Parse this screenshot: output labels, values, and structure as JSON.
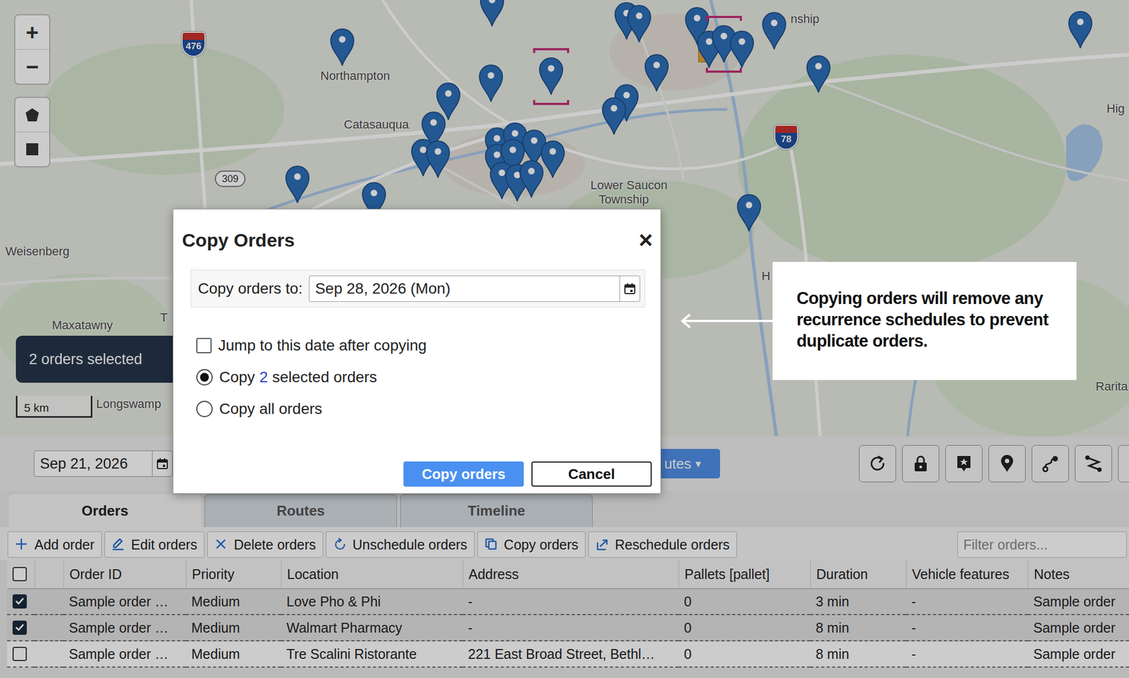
{
  "map": {
    "zoom_controls": [
      "+",
      "−"
    ],
    "labels": [
      "Northampton",
      "Catasauqua",
      "Weisenberg",
      "Maxatawny",
      "Longswamp",
      "Lower Saucon",
      "Township",
      "nship",
      "Hig",
      "H",
      "Rarita",
      "T"
    ],
    "shields": [
      "476",
      "309",
      "78"
    ],
    "pins": [
      {
        "selected": false
      },
      {
        "selected": false
      },
      {
        "selected": true
      },
      {
        "selected": false
      },
      {
        "selected": false
      },
      {
        "selected": false
      },
      {
        "selected": false
      },
      {
        "selected": false
      },
      {
        "selected": false
      },
      {
        "selected": false
      },
      {
        "selected": false
      },
      {
        "selected": false
      },
      {
        "selected": false
      },
      {
        "selected": false
      },
      {
        "selected": true
      },
      {
        "selected": false
      },
      {
        "selected": false
      },
      {
        "selected": false
      },
      {
        "selected": false
      },
      {
        "selected": false
      },
      {
        "selected": false
      },
      {
        "selected": false
      },
      {
        "selected": false
      },
      {
        "selected": false
      },
      {
        "selected": false
      },
      {
        "selected": false
      },
      {
        "selected": false
      },
      {
        "selected": false
      },
      {
        "selected": false
      },
      {
        "selected": false
      },
      {
        "selected": false
      },
      {
        "selected": false
      }
    ],
    "selection_badge": "2 orders selected",
    "scale": "5 km"
  },
  "toolbar": {
    "date": "Sep 21, 2026",
    "routes_button": {
      "label": "utes",
      "caret": "▾"
    }
  },
  "tabs": [
    {
      "label": "Orders",
      "selected": true
    },
    {
      "label": "Routes",
      "selected": false
    },
    {
      "label": "Timeline",
      "selected": false
    }
  ],
  "actions": [
    "Add order",
    "Edit orders",
    "Delete orders",
    "Unschedule orders",
    "Copy orders",
    "Reschedule orders"
  ],
  "filter": {
    "placeholder": "Filter orders..."
  },
  "table": {
    "header_checked": false,
    "columns": [
      "Order ID",
      "Priority",
      "Location",
      "Address",
      "Pallets [pallet]",
      "Duration",
      "Vehicle features",
      "Notes"
    ],
    "rows": [
      {
        "checked": true,
        "selected": true,
        "cells": [
          "Sample order …",
          "Medium",
          "Love Pho & Phi",
          "-",
          "0",
          "3 min",
          "-",
          "Sample order"
        ]
      },
      {
        "checked": true,
        "selected": true,
        "cells": [
          "Sample order …",
          "Medium",
          "Walmart Pharmacy",
          "-",
          "0",
          "8 min",
          "-",
          "Sample order"
        ]
      },
      {
        "checked": false,
        "selected": false,
        "cells": [
          "Sample order …",
          "Medium",
          "Tre Scalini Ristorante",
          "221 East Broad Street, Bethl…",
          "0",
          "8 min",
          "-",
          "Sample order"
        ]
      }
    ]
  },
  "dialog": {
    "title": "Copy Orders",
    "close": "×",
    "date_label": "Copy orders to:",
    "date_value": "Sep 28, 2026 (Mon)",
    "jump": {
      "label": "Jump to this date after copying",
      "checked": false
    },
    "options": [
      {
        "text": "Copy",
        "count": "2",
        "text_after": "selected orders",
        "selected": true
      },
      {
        "text": "Copy all orders",
        "selected": false
      }
    ],
    "buttons": [
      {
        "label": "Copy orders",
        "kind": "primary"
      },
      {
        "label": "Cancel",
        "kind": "secondary"
      }
    ]
  },
  "callout": {
    "text": "Copying orders will remove any recurrence schedules to prevent duplicate orders."
  }
}
